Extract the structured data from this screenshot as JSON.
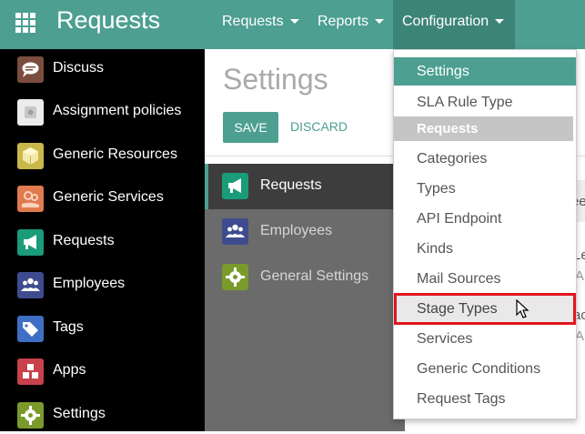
{
  "app": {
    "title": "Requests"
  },
  "top_menu": [
    {
      "label": "Requests"
    },
    {
      "label": "Reports"
    },
    {
      "label": "Configuration"
    }
  ],
  "sidebar": {
    "items": [
      {
        "label": "Discuss",
        "icon": "chat-bubble-icon",
        "color": "#7b4d3e"
      },
      {
        "label": "Assignment policies",
        "icon": "assignment-icon",
        "color": "#e8e8e8"
      },
      {
        "label": "Generic Resources",
        "icon": "cube-icon",
        "color": "#c9b84c"
      },
      {
        "label": "Generic Services",
        "icon": "gears-hand-icon",
        "color": "#e07a4f"
      },
      {
        "label": "Requests",
        "icon": "megaphone-icon",
        "color": "#1a9b7a"
      },
      {
        "label": "Employees",
        "icon": "people-icon",
        "color": "#3e4c8f"
      },
      {
        "label": "Tags",
        "icon": "tags-icon",
        "color": "#3f6fc4"
      },
      {
        "label": "Apps",
        "icon": "cubes-icon",
        "color": "#c8424b"
      },
      {
        "label": "Settings",
        "icon": "gear-icon",
        "color": "#7a9a2b"
      }
    ]
  },
  "settings": {
    "title": "Settings",
    "save_label": "SAVE",
    "discard_label": "DISCARD",
    "nav": [
      {
        "label": "Requests",
        "icon": "megaphone-icon",
        "color": "#1a9b7a"
      },
      {
        "label": "Employees",
        "icon": "people-icon",
        "color": "#3e4c8f"
      },
      {
        "label": "General Settings",
        "icon": "gear-icon",
        "color": "#7a9a2b"
      }
    ],
    "peek_texts": [
      "ee",
      "Le",
      "A",
      "ac",
      "A"
    ]
  },
  "dropdown": {
    "items": [
      {
        "label": "Settings",
        "type": "selected"
      },
      {
        "label": "SLA Rule Type",
        "type": "item"
      },
      {
        "label": "Requests",
        "type": "header"
      },
      {
        "label": "Categories",
        "type": "item"
      },
      {
        "label": "Types",
        "type": "item"
      },
      {
        "label": "API Endpoint",
        "type": "item"
      },
      {
        "label": "Kinds",
        "type": "item"
      },
      {
        "label": "Mail Sources",
        "type": "item"
      },
      {
        "label": "Stage Types",
        "type": "highlight"
      },
      {
        "label": "Services",
        "type": "item"
      },
      {
        "label": "Generic Conditions",
        "type": "item"
      },
      {
        "label": "Request Tags",
        "type": "item"
      }
    ]
  },
  "colors": {
    "brand": "#4c9f91",
    "highlight_border": "#e0161c"
  }
}
